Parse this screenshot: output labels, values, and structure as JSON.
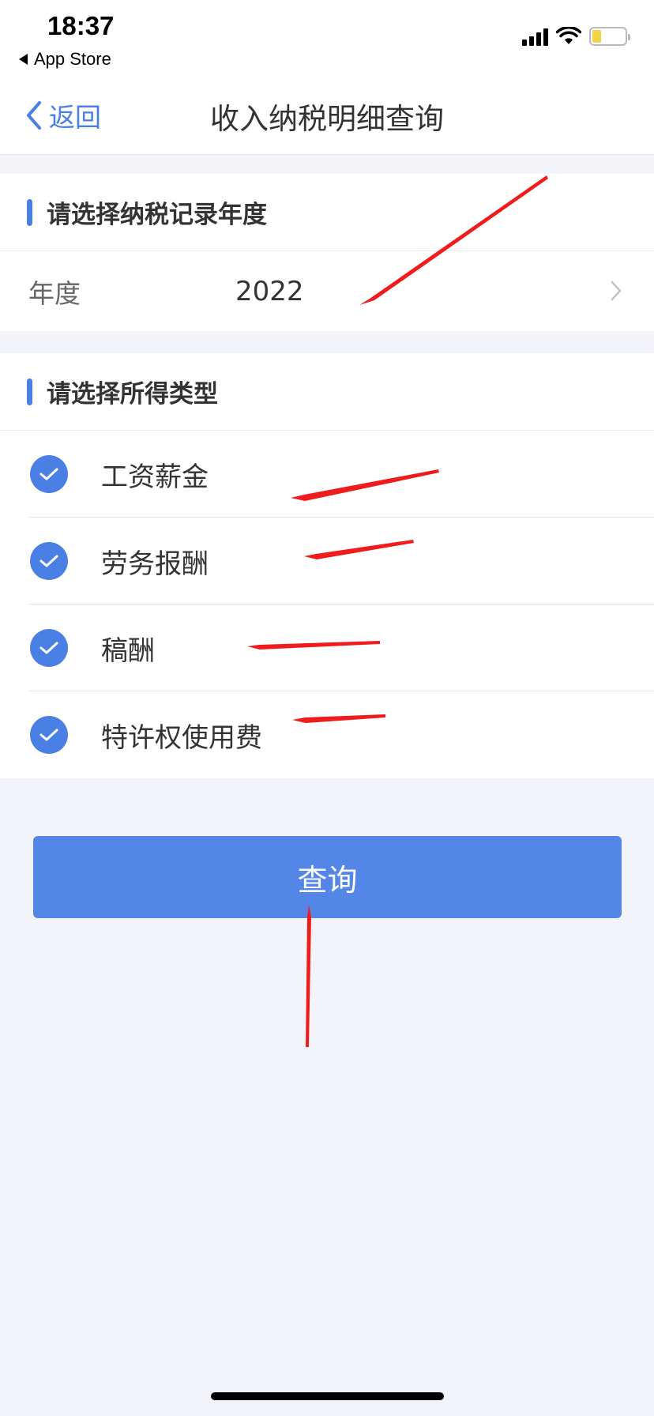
{
  "status_bar": {
    "time": "18:37",
    "back_app": "App Store"
  },
  "nav": {
    "back_label": "返回",
    "title": "收入纳税明细查询"
  },
  "year_section": {
    "title": "请选择纳税记录年度",
    "label": "年度",
    "value": "2022"
  },
  "income_section": {
    "title": "请选择所得类型",
    "items": [
      {
        "label": "工资薪金",
        "checked": true
      },
      {
        "label": "劳务报酬",
        "checked": true
      },
      {
        "label": "稿酬",
        "checked": true
      },
      {
        "label": "特许权使用费",
        "checked": true
      }
    ]
  },
  "query_button": {
    "label": "查询"
  },
  "colors": {
    "accent": "#4a80e3",
    "button": "#5486e8",
    "background": "#f3f4f9",
    "annotation_arrow": "#ee1c1c",
    "battery": "#f5d348"
  }
}
